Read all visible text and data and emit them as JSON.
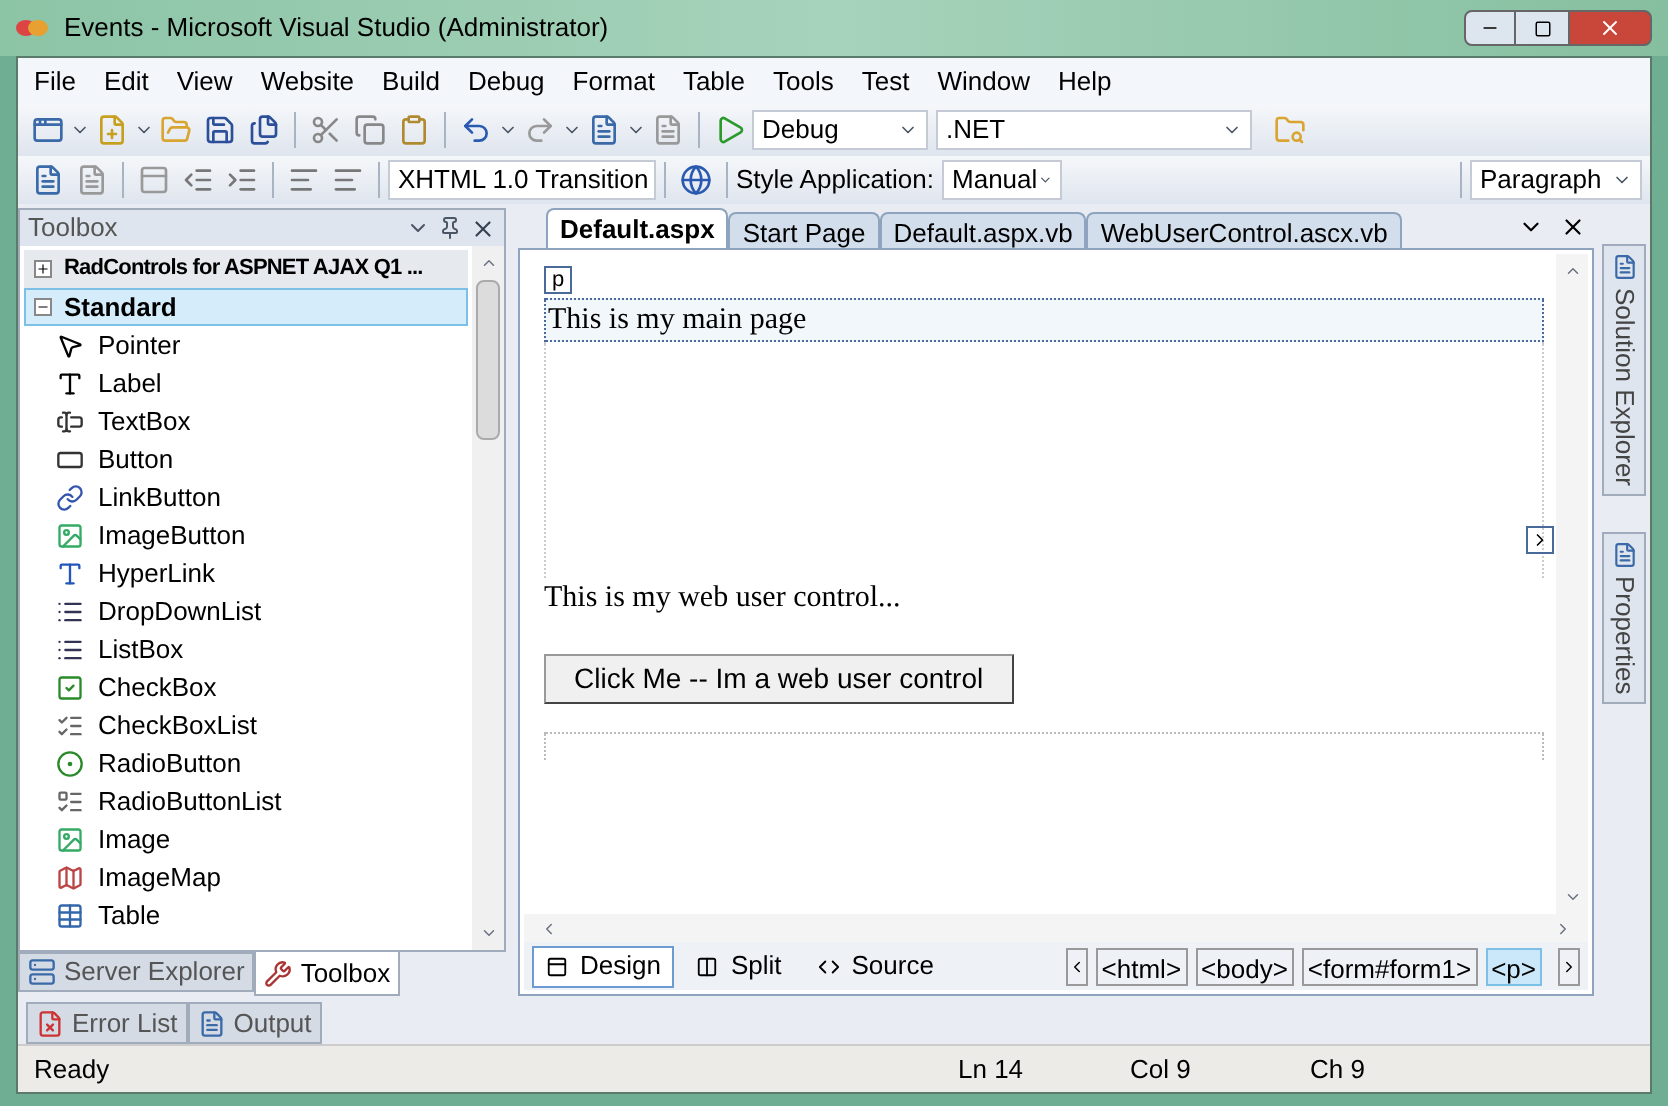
{
  "window": {
    "title": "Events - Microsoft Visual Studio (Administrator)"
  },
  "menu": [
    "File",
    "Edit",
    "View",
    "Website",
    "Build",
    "Debug",
    "Format",
    "Table",
    "Tools",
    "Test",
    "Window",
    "Help"
  ],
  "toolbar_1": {
    "configuration": "Debug",
    "platform": ".NET"
  },
  "toolbar_2": {
    "schema": "XHTML 1.0 Transition",
    "style_application_label": "Style Application:",
    "style_application": "Manual",
    "block_format": "Paragraph"
  },
  "toolbox": {
    "title": "Toolbox",
    "groups": [
      {
        "label": "RadControls for ASPNET AJAX Q1 ...",
        "expanded": false,
        "selected": false
      },
      {
        "label": "Standard",
        "expanded": true,
        "selected": true,
        "items": [
          "Pointer",
          "Label",
          "TextBox",
          "Button",
          "LinkButton",
          "ImageButton",
          "HyperLink",
          "DropDownList",
          "ListBox",
          "CheckBox",
          "CheckBoxList",
          "RadioButton",
          "RadioButtonList",
          "Image",
          "ImageMap",
          "Table"
        ]
      }
    ]
  },
  "toolbox_tabs": [
    {
      "label": "Server Explorer",
      "selected": false
    },
    {
      "label": "Toolbox",
      "selected": true
    }
  ],
  "document_tabs": [
    {
      "label": "Default.aspx",
      "selected": true
    },
    {
      "label": "Start Page",
      "selected": false
    },
    {
      "label": "Default.aspx.vb",
      "selected": false
    },
    {
      "label": "WebUserControl.ascx.vb",
      "selected": false
    }
  ],
  "design_surface": {
    "tag_label": "p",
    "main_text": "This is my main page",
    "control_text": "This is my web user control...",
    "control_button": "Click Me -- Im a web user control"
  },
  "view_tabs": [
    {
      "label": "Design",
      "selected": true
    },
    {
      "label": "Split",
      "selected": false
    },
    {
      "label": "Source",
      "selected": false
    }
  ],
  "tag_path": [
    {
      "label": "<html>",
      "selected": false
    },
    {
      "label": "<body>",
      "selected": false
    },
    {
      "label": "<form#form1>",
      "selected": false
    },
    {
      "label": "<p>",
      "selected": true
    }
  ],
  "side_tabs": [
    "Solution Explorer",
    "Properties"
  ],
  "bottom_tabs": [
    "Error List",
    "Output"
  ],
  "status_bar": {
    "message": "Ready",
    "line": "Ln 14",
    "column": "Col 9",
    "character": "Ch 9"
  }
}
